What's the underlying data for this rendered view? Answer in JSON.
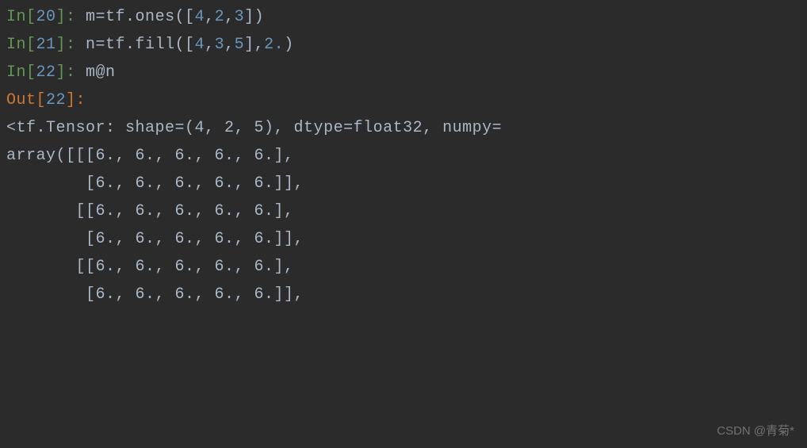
{
  "cells": {
    "in20": {
      "prompt_prefix": "In[",
      "prompt_num": "20",
      "prompt_suffix": "]:",
      "code_pre": " m=tf.ones([",
      "num1": "4",
      "comma1": ",",
      "num2": "2",
      "comma2": ",",
      "num3": "3",
      "code_post": "])"
    },
    "in21": {
      "prompt_prefix": "In[",
      "prompt_num": "21",
      "prompt_suffix": "]:",
      "code_pre": " n=tf.fill([",
      "num1": "4",
      "comma1": ",",
      "num2": "3",
      "comma2": ",",
      "num3": "5",
      "code_mid": "],",
      "num4": "2.",
      "code_post": ")"
    },
    "in22": {
      "prompt_prefix": "In[",
      "prompt_num": "22",
      "prompt_suffix": "]:",
      "code": " m@n"
    },
    "out22": {
      "prompt_prefix": "Out[",
      "prompt_num": "22",
      "prompt_suffix": "]:"
    }
  },
  "output": {
    "line1": "<tf.Tensor: shape=(4, 2, 5), dtype=float32, numpy=",
    "line2": "array([[[6., 6., 6., 6., 6.],",
    "line3": "        [6., 6., 6., 6., 6.]],",
    "line4": "",
    "line5": "       [[6., 6., 6., 6., 6.],",
    "line6": "        [6., 6., 6., 6., 6.]],",
    "line7": "",
    "line8": "       [[6., 6., 6., 6., 6.],",
    "line9": "        [6., 6., 6., 6., 6.]],"
  },
  "watermark": "CSDN @青菊*"
}
